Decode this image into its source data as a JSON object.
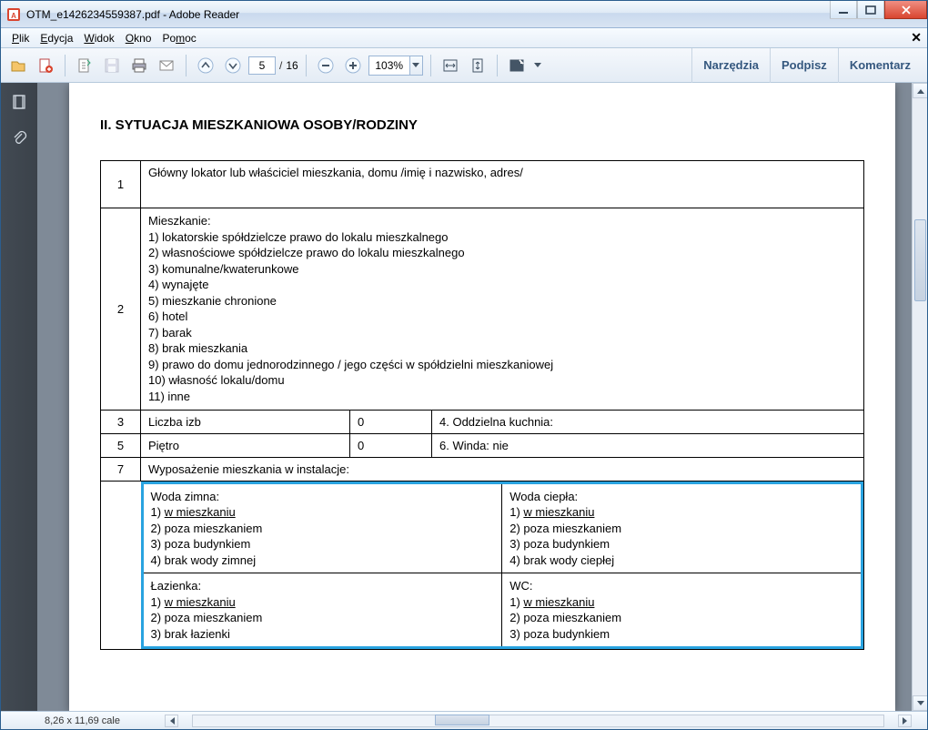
{
  "window": {
    "title": "OTM_e1426234559387.pdf - Adobe Reader"
  },
  "menu": {
    "plik": "Plik",
    "edycja": "Edycja",
    "widok": "Widok",
    "okno": "Okno",
    "pomoc": "Pomoc"
  },
  "toolbar": {
    "page_current": "5",
    "page_total": "16",
    "zoom": "103%",
    "narzedzia": "Narzędzia",
    "podpisz": "Podpisz",
    "komentarz": "Komentarz"
  },
  "doc": {
    "heading": "II. SYTUACJA MIESZKANIOWA OSOBY/RODZINY",
    "row1_num": "1",
    "row1_text": "Główny lokator lub właściciel mieszkania, domu /imię i nazwisko, adres/",
    "row2_num": "2",
    "row2_title": "Mieszkanie:",
    "row2_items": [
      "1) lokatorskie spółdzielcze prawo do lokalu mieszkalnego",
      "2) własnościowe spółdzielcze prawo do lokalu mieszkalnego",
      "3) komunalne/kwaterunkowe",
      "4) wynajęte",
      "5) mieszkanie chronione",
      "6) hotel",
      "7) barak",
      "8) brak mieszkania",
      "9) prawo do domu jednorodzinnego / jego części w spółdzielni mieszkaniowej",
      "10) własność lokalu/domu",
      "11) inne"
    ],
    "row3_num": "3",
    "row3_label": "Liczba izb",
    "row3_val": "0",
    "row4_label": "4. Oddzielna kuchnia:",
    "row5_num": "5",
    "row5_label": "Piętro",
    "row5_val": "0",
    "row6_label": "6. Winda: nie",
    "row7_num": "7",
    "row7_label": "Wyposażenie mieszkania w instalacje:",
    "woda_zimna_title": "Woda zimna:",
    "woda_zimna": [
      "1) w mieszkaniu",
      "2) poza mieszkaniem",
      "3) poza budynkiem",
      "4) brak wody zimnej"
    ],
    "woda_ciepla_title": "Woda ciepła:",
    "woda_ciepla": [
      "1) w mieszkaniu",
      "2) poza mieszkaniem",
      "3) poza budynkiem",
      "4) brak wody ciepłej"
    ],
    "lazienka_title": "Łazienka:",
    "lazienka": [
      "1) w mieszkaniu",
      "2) poza mieszkaniem",
      "3) brak łazienki"
    ],
    "wc_title": "WC:",
    "wc": [
      "1) w mieszkaniu",
      "2) poza mieszkaniem",
      "3) poza budynkiem"
    ]
  },
  "status": {
    "dimensions": "8,26 x 11,69 cale"
  }
}
